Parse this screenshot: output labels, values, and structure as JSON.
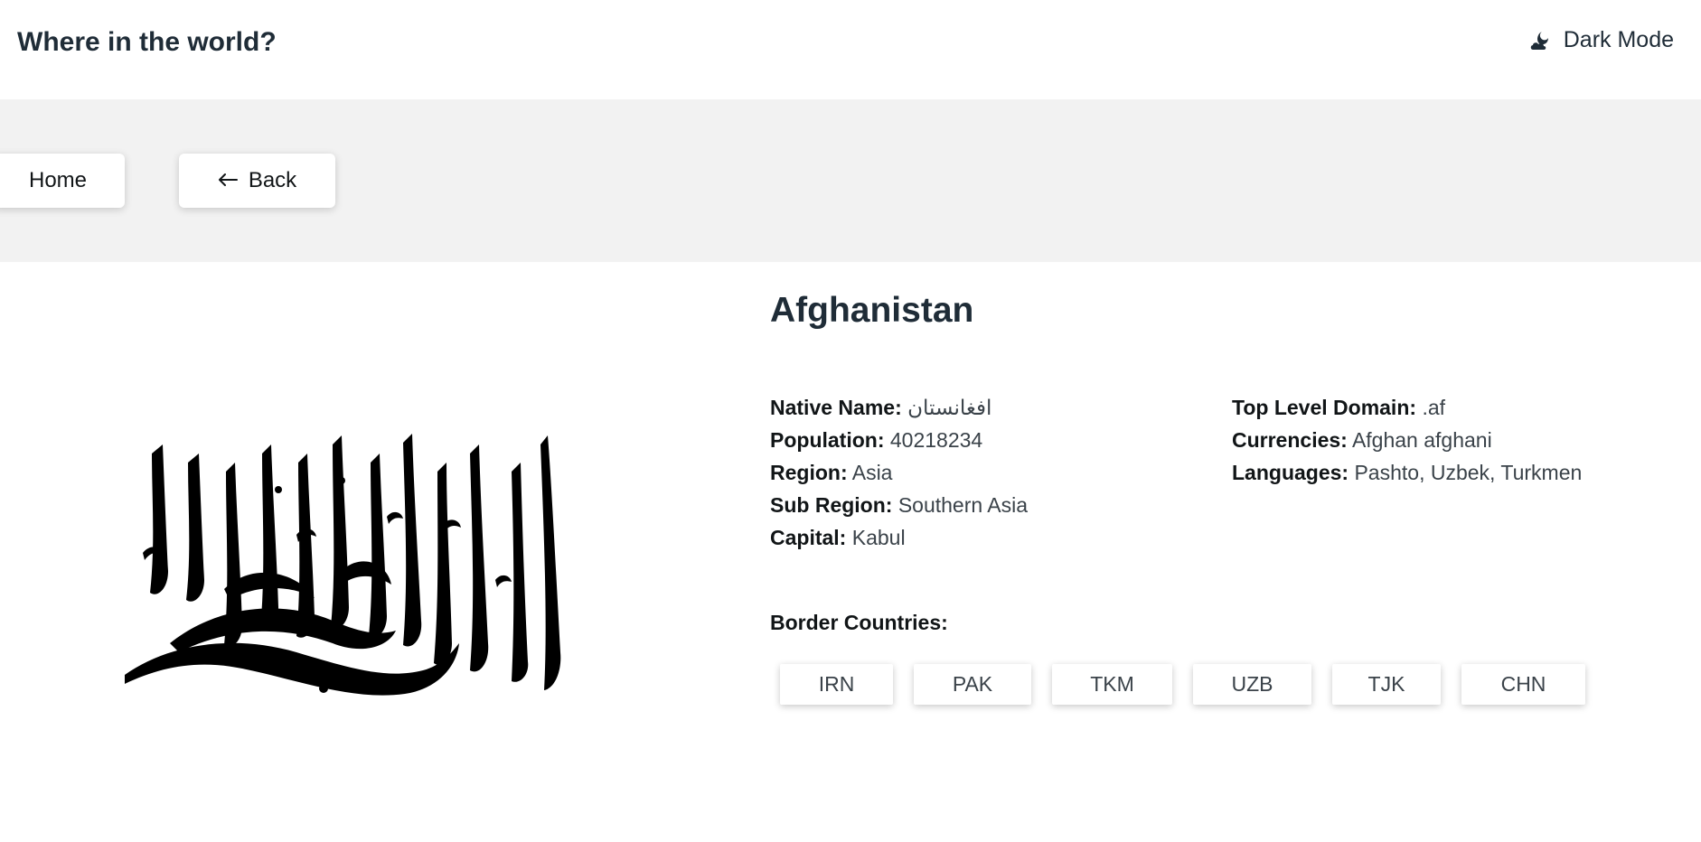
{
  "header": {
    "title": "Where in the world?",
    "dark_mode_label": "Dark Mode",
    "dark_mode_icon": "moon-cloud-icon"
  },
  "nav": {
    "home_label": "Home",
    "back_label": "Back",
    "back_icon": "arrow-left-icon"
  },
  "country": {
    "name": "Afghanistan",
    "flag_description": "flag-image",
    "details_left": [
      {
        "label": "Native Name:",
        "value": "افغانستان"
      },
      {
        "label": "Population:",
        "value": "40218234"
      },
      {
        "label": "Region:",
        "value": "Asia"
      },
      {
        "label": "Sub Region:",
        "value": "Southern Asia"
      },
      {
        "label": "Capital:",
        "value": "Kabul"
      }
    ],
    "details_right": [
      {
        "label": "Top Level Domain:",
        "value": ".af"
      },
      {
        "label": "Currencies:",
        "value": "Afghan afghani"
      },
      {
        "label": "Languages:",
        "value": "Pashto, Uzbek, Turkmen"
      }
    ],
    "border_label": "Border Countries:",
    "borders": [
      "IRN",
      "PAK",
      "TKM",
      "UZB",
      "TJK",
      "CHN"
    ]
  },
  "colors": {
    "text_dark": "#111517",
    "band_bg": "#f2f2f2"
  }
}
